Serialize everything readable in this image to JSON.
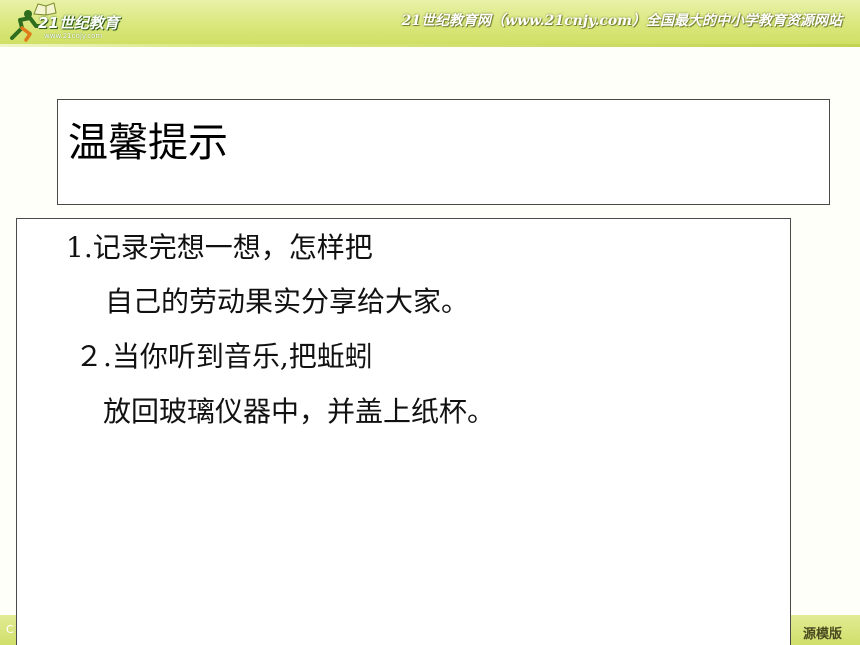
{
  "header": {
    "logo_text": "21世纪教育",
    "logo_url": "www.21cnjy.com",
    "slogan": "21世纪教育网（www.21cnjy.com）全国最大的中小学教育资源网站"
  },
  "slide": {
    "title": "温馨提示",
    "lines": [
      "1.记录完想一想，怎样把",
      "自己的劳动果实分享给大家。",
      "２.当你听到音乐,把蚯蚓",
      "放回玻璃仪器中，并盖上纸杯。"
    ]
  },
  "footer": {
    "left_text": "C",
    "right_text": "源模版"
  },
  "colors": {
    "banner": "#d9e77c",
    "background": "#fffffa",
    "border": "#4a4a4a"
  }
}
